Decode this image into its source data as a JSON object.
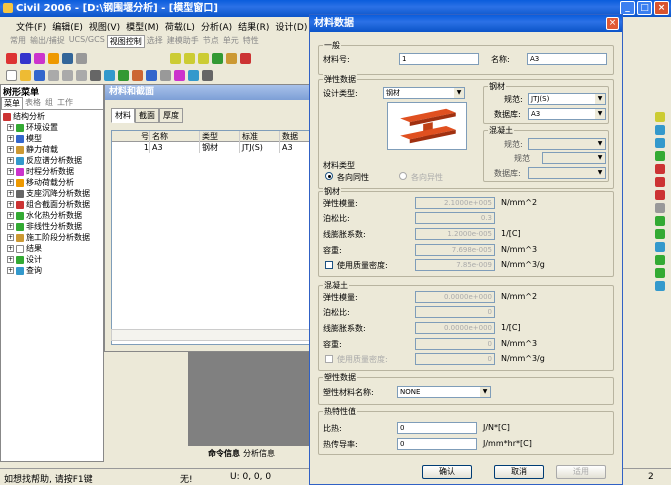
{
  "app": {
    "title": "Civil 2006 - [D:\\钢围堰分析] - [模型窗口]"
  },
  "menu": [
    "文件(F)",
    "编辑(E)",
    "视图(V)",
    "模型(M)",
    "荷载(L)",
    "分析(A)",
    "结果(R)",
    "设计(D)"
  ],
  "ribbon_tabs": [
    "常用",
    "输出/捕捉",
    "UCS/GCS",
    "视图控制",
    "选择",
    "建模助手",
    "节点",
    "单元",
    "特性"
  ],
  "left_panel": {
    "title": "树形菜单",
    "tabs": [
      "菜单",
      "表格",
      "组",
      "工作"
    ],
    "root": "结构分析",
    "items": [
      "环境设置",
      "模型",
      "静力荷载",
      "反应谱分析数据",
      "时程分析数据",
      "移动荷载分析",
      "支座沉降分析数据",
      "组合截面分析数据",
      "水化热分析数据",
      "非线性分析数据",
      "施工阶段分析数据",
      "结果",
      "设计",
      "查询"
    ]
  },
  "material_window": {
    "title": "材料和截面",
    "tabs": [
      "材料",
      "截面",
      "厚度"
    ],
    "columns": [
      "号",
      "名称",
      "类型",
      "标准",
      "数据"
    ],
    "rows": [
      [
        "1",
        "A3",
        "钢材",
        "JTJ(S)",
        "A3"
      ]
    ]
  },
  "bottom_tabs": [
    "命令信息",
    "分析信息"
  ],
  "status": {
    "help": "如想找帮助, 请按F1键",
    "none": "无!",
    "coords": "U: 0, 0, 0",
    "page": "2"
  },
  "dialog": {
    "title": "材料数据",
    "general": {
      "label": "一般",
      "id_label": "材料号:",
      "id_value": "1",
      "name_label": "名称:",
      "name_value": "A3"
    },
    "elastic": {
      "label": "弹性数据",
      "design_type_label": "设计类型:",
      "design_type_value": "钢材",
      "steel_label": "钢材",
      "spec_label": "规范:",
      "spec_value": "JTJ(S)",
      "db_label": "数据库:",
      "db_value": "A3",
      "concrete_label": "混凝土",
      "c_spec_label": "规范:",
      "c_spec2_label": "规范",
      "c_db_label": "数据库:",
      "mattype_label": "材料类型",
      "isotropic": "各向同性",
      "orthotropic": "各向异性"
    },
    "steel_props": {
      "label": "钢材",
      "rows": [
        {
          "label": "弹性模量:",
          "value": "2.1000e+005",
          "unit": "N/mm^2"
        },
        {
          "label": "泊松比:",
          "value": "0.3",
          "unit": ""
        },
        {
          "label": "线膨胀系数:",
          "value": "1.2000e-005",
          "unit": "1/[C]"
        },
        {
          "label": "容重:",
          "value": "7.698e-005",
          "unit": "N/mm^3"
        }
      ],
      "mass_label": "使用质量密度:",
      "mass_value": "7.85e-009",
      "mass_unit": "N/mm^3/g"
    },
    "concrete_props": {
      "label": "混凝土",
      "rows": [
        {
          "label": "弹性模量:",
          "value": "0.0000e+000",
          "unit": "N/mm^2"
        },
        {
          "label": "泊松比:",
          "value": "0",
          "unit": ""
        },
        {
          "label": "线膨胀系数:",
          "value": "0.0000e+000",
          "unit": "1/[C]"
        },
        {
          "label": "容重:",
          "value": "0",
          "unit": "N/mm^3"
        }
      ],
      "mass_label": "使用质量密度:",
      "mass_value": "0",
      "mass_unit": "N/mm^3/g"
    },
    "plastic": {
      "label": "塑性数据",
      "name_label": "塑性材料名称:",
      "name_value": "NONE"
    },
    "thermal": {
      "label": "热特性值",
      "specific_heat_label": "比热:",
      "specific_heat_value": "0",
      "specific_heat_unit": "J/N*[C]",
      "conductivity_label": "热传导率:",
      "conductivity_value": "0",
      "conductivity_unit": "J/mm*hr*[C]"
    },
    "buttons": {
      "ok": "确认",
      "cancel": "取消",
      "apply": "适用"
    }
  }
}
